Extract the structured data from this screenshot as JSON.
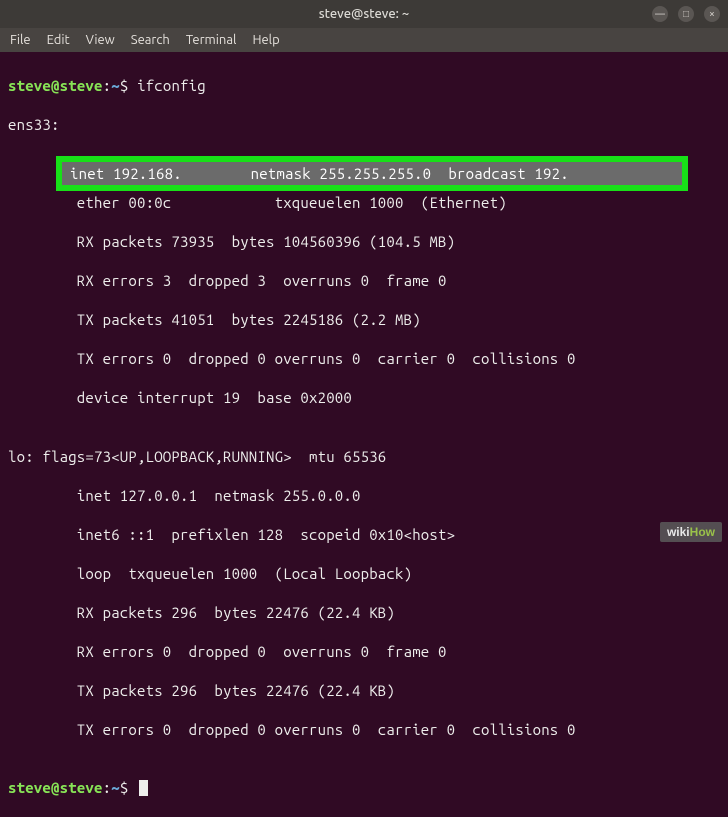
{
  "window": {
    "title": "steve@steve: ~",
    "controls": {
      "minimize": "—",
      "maximize": "□",
      "close": "×"
    }
  },
  "menu": {
    "file": "File",
    "edit": "Edit",
    "view": "View",
    "search": "Search",
    "terminal": "Terminal",
    "help": "Help"
  },
  "prompt": {
    "user": "steve",
    "at": "@",
    "host": "steve",
    "colon": ":",
    "path": "~",
    "symbol": "$ "
  },
  "command": "ifconfig",
  "output": {
    "l0": "ens33:",
    "hl": "inet 192.168.        netmask 255.255.255.0  broadcast 192.",
    "l2": "        ether 00:0c            txqueuelen 1000  (Ethernet)",
    "l3": "        RX packets 73935  bytes 104560396 (104.5 MB)",
    "l4": "        RX errors 3  dropped 3  overruns 0  frame 0",
    "l5": "        TX packets 41051  bytes 2245186 (2.2 MB)",
    "l6": "        TX errors 0  dropped 0 overruns 0  carrier 0  collisions 0",
    "l7": "        device interrupt 19  base 0x2000",
    "l8": "",
    "l9": "lo: flags=73<UP,LOOPBACK,RUNNING>  mtu 65536",
    "l10": "        inet 127.0.0.1  netmask 255.0.0.0",
    "l11": "        inet6 ::1  prefixlen 128  scopeid 0x10<host>",
    "l12": "        loop  txqueuelen 1000  (Local Loopback)",
    "l13": "        RX packets 296  bytes 22476 (22.4 KB)",
    "l14": "        RX errors 0  dropped 0  overruns 0  frame 0",
    "l15": "        TX packets 296  bytes 22476 (22.4 KB)",
    "l16": "        TX errors 0  dropped 0 overruns 0  carrier 0  collisions 0",
    "l17": ""
  },
  "watermark": {
    "wiki": "wiki",
    "how": "How"
  }
}
